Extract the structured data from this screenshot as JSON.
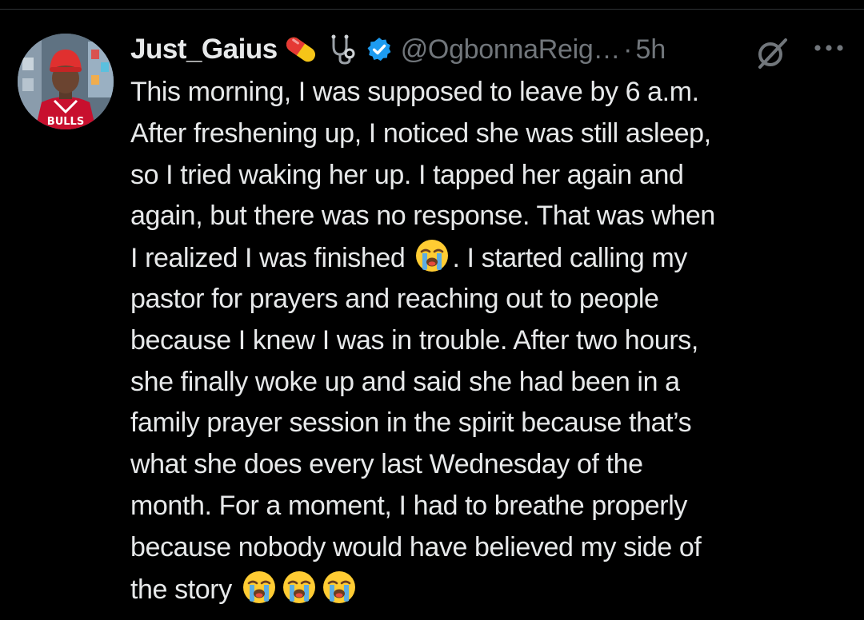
{
  "tweet": {
    "author": {
      "display_name": "Just_Gaius",
      "handle": "@OgbonnaReig…",
      "separator": "·",
      "time": "5h",
      "name_emoji": [
        "pill-icon",
        "stethoscope-icon"
      ],
      "verified": true,
      "verified_color": "#1d9bf0"
    },
    "lines": [
      "This morning, I was supposed to leave by 6 a.m.",
      "After freshening up, I noticed she was still asleep,",
      "so I tried waking her up. I tapped her again and",
      "again, but there was no response. That was when",
      {
        "before": "I realized I was finished ",
        "emoji": "loudly-crying-face",
        "after": ". I started calling my"
      },
      "pastor for prayers and reaching out to people",
      "because I knew I was in trouble. After two hours,",
      "she finally woke up and said she had been in a",
      "family prayer session in the spirit because that’s",
      "what she does every last Wednesday of the",
      "month. For a moment, I had to breathe properly",
      "because nobody would have believed my side of",
      {
        "before": "the story ",
        "emoji_count": 3,
        "emoji": "loudly-crying-face"
      }
    ]
  },
  "colors": {
    "background": "#000000",
    "text": "#e7e9ea",
    "secondary_text": "#71767b",
    "accent": "#1d9bf0"
  }
}
